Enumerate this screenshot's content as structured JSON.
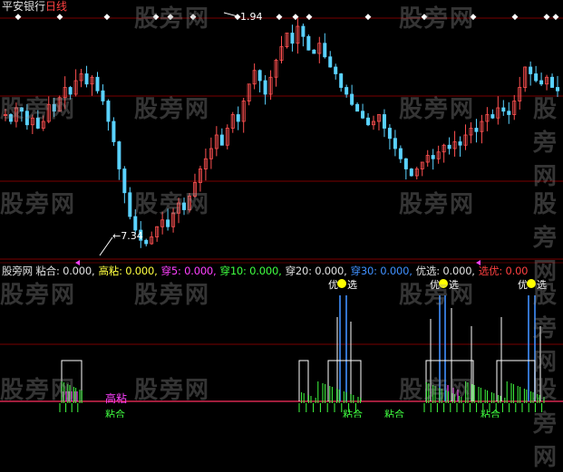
{
  "title": {
    "stock_name": "平安银行",
    "period": "日线"
  },
  "watermark_text": "股旁网",
  "price_panel": {
    "high_marker": "1.94",
    "low_marker": "7.34",
    "colors": {
      "up": "#ff5050",
      "down": "#5ad2ff",
      "grid": "#7a0000",
      "marker": "#ffffff",
      "arrow": "#ff40ff"
    }
  },
  "indicator_bar": [
    {
      "label": "股旁网 粘合",
      "value": "0.000",
      "color": "#e0e0e0"
    },
    {
      "label": "高粘",
      "value": "0.000",
      "color": "#ffff40"
    },
    {
      "label": "穿5",
      "value": "0.000",
      "color": "#ff40ff"
    },
    {
      "label": "穿10",
      "value": "0.000",
      "color": "#40ff40"
    },
    {
      "label": "穿20",
      "value": "0.000",
      "color": "#e0e0e0"
    },
    {
      "label": "穿30",
      "value": "0.000",
      "color": "#4090ff"
    },
    {
      "label": "优选",
      "value": "0.000",
      "color": "#e0e0e0"
    },
    {
      "label": "选优",
      "value": "0.00",
      "color": "#ff4040"
    }
  ],
  "lower_panel": {
    "signal_label": "优选",
    "high_stick_label": "高粘",
    "merge_label": "粘合",
    "colors": {
      "blue": "#4090ff",
      "white": "#ffffff",
      "magenta": "#ff40ff",
      "green": "#40ff40",
      "yellow": "#ffff00",
      "line": "#ff3060"
    }
  },
  "chart_data": {
    "type": "candlestick",
    "title": "平安银行 日线",
    "annotations": [
      "1.94",
      "7.34"
    ],
    "close_series_estimate": [
      11.2,
      11.0,
      11.4,
      11.3,
      10.9,
      11.1,
      10.8,
      11.0,
      11.5,
      11.3,
      11.7,
      12.0,
      11.8,
      12.2,
      12.4,
      12.1,
      12.3,
      11.9,
      11.6,
      11.0,
      10.4,
      9.6,
      8.9,
      8.2,
      7.8,
      7.5,
      7.4,
      7.6,
      7.9,
      8.1,
      7.9,
      8.3,
      8.6,
      8.4,
      8.8,
      9.2,
      9.6,
      9.9,
      10.2,
      10.6,
      10.3,
      10.8,
      11.2,
      11.0,
      11.6,
      12.1,
      12.5,
      12.2,
      11.8,
      12.3,
      12.8,
      13.2,
      13.6,
      13.3,
      13.8,
      13.5,
      13.1,
      13.0,
      13.3,
      12.9,
      12.6,
      12.4,
      12.0,
      11.8,
      11.5,
      11.3,
      11.1,
      10.9,
      11.0,
      11.2,
      10.8,
      10.5,
      10.2,
      9.9,
      9.6,
      9.4,
      9.6,
      9.8,
      10.0,
      9.9,
      10.1,
      10.3,
      10.2,
      10.4,
      10.3,
      10.6,
      10.8,
      10.7,
      11.0,
      11.2,
      11.1,
      11.4,
      11.3,
      11.2,
      11.6,
      12.0,
      12.6,
      12.4,
      12.2,
      12.1,
      12.3,
      12.0,
      11.9
    ]
  }
}
